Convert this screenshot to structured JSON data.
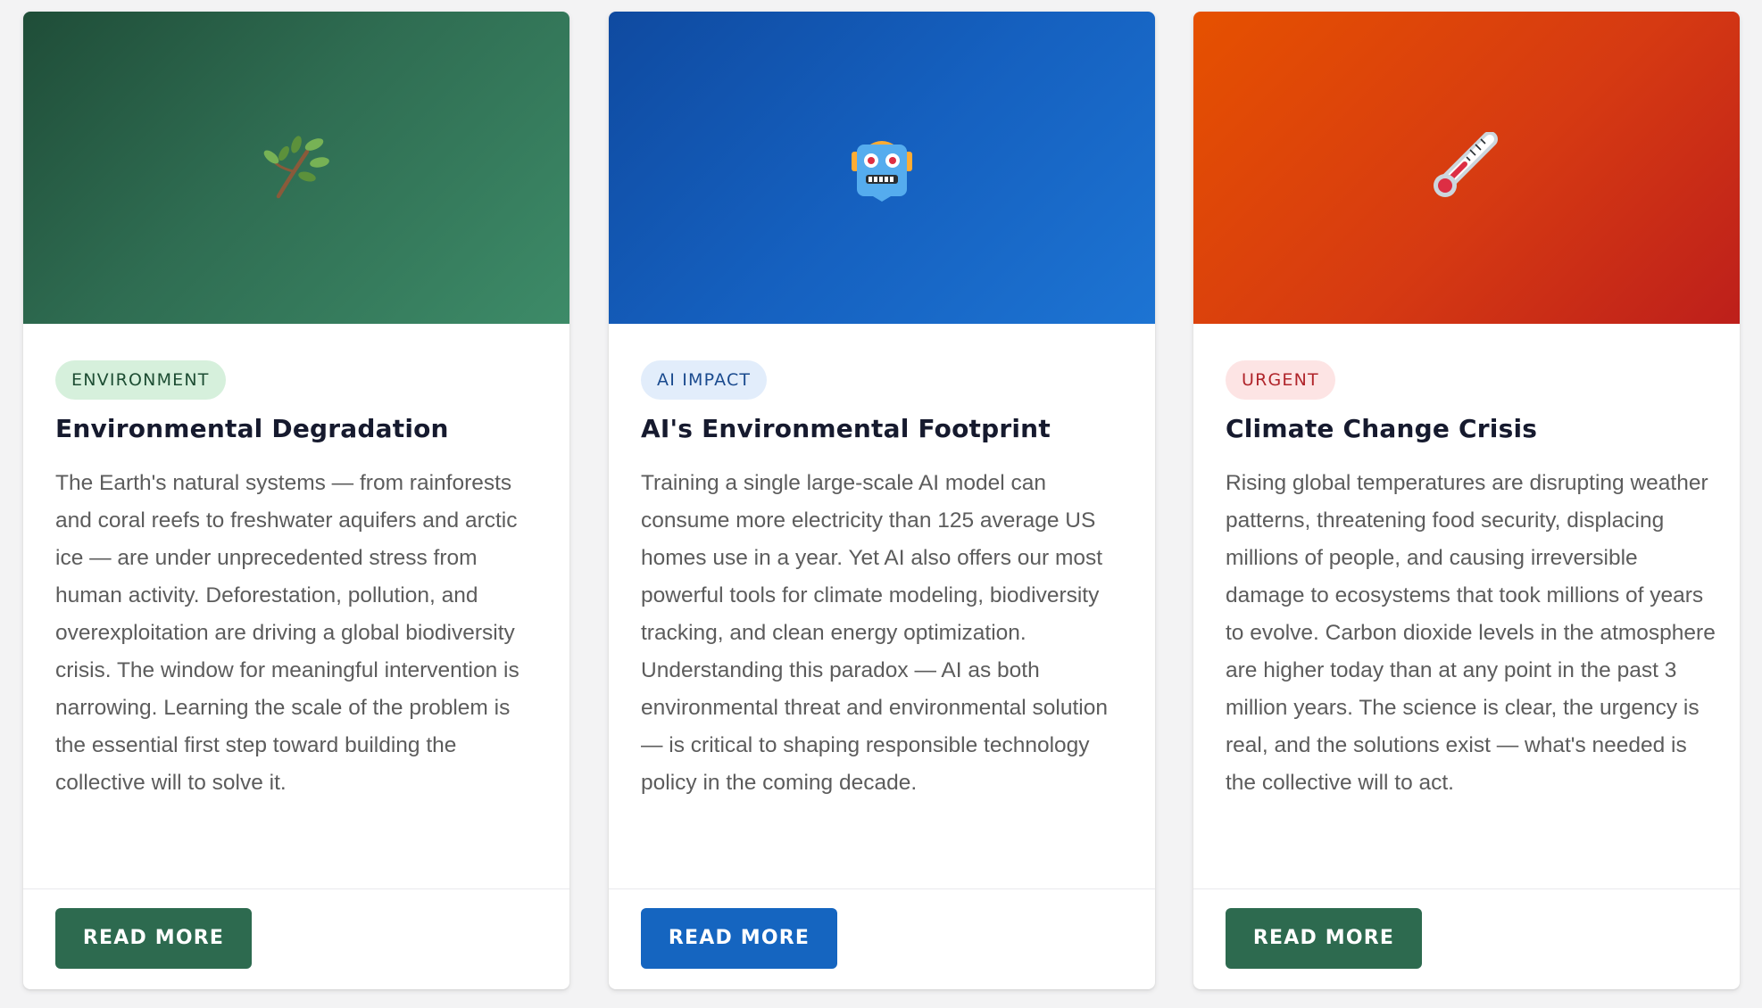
{
  "cards": [
    {
      "icon": "leaf-branch-icon",
      "tag": "ENVIRONMENT",
      "title": "Environmental Degradation",
      "body": "The Earth's natural systems — from rainforests and coral reefs to freshwater aquifers and arctic ice — are under unprecedented stress from human activity. Deforestation, pollution, and overexploitation are driving a global biodiversity crisis. The window for meaningful intervention is narrowing. Learning the scale of the problem is the essential first step toward building the collective will to solve it.",
      "button": "READ MORE",
      "accent": "#2d6a4f"
    },
    {
      "icon": "robot-icon",
      "tag": "AI IMPACT",
      "title": "AI's Environmental Footprint",
      "body": "Training a single large-scale AI model can consume more electricity than 125 average US homes use in a year. Yet AI also offers our most powerful tools for climate modeling, biodiversity tracking, and clean energy optimization. Understanding this paradox — AI as both environmental threat and environmental solution — is critical to shaping responsible technology policy in the coming decade.",
      "button": "READ MORE",
      "accent": "#1565c0"
    },
    {
      "icon": "thermometer-icon",
      "tag": "URGENT",
      "title": "Climate Change Crisis",
      "body": "Rising global temperatures are disrupting weather patterns, threatening food security, displacing millions of people, and causing irreversible damage to ecosystems that took millions of years to evolve. Carbon dioxide levels in the atmosphere are higher today than at any point in the past 3 million years. The science is clear, the urgency is real, and the solutions exist — what's needed is the collective will to act.",
      "button": "READ MORE",
      "accent": "#2d6a4f"
    }
  ]
}
